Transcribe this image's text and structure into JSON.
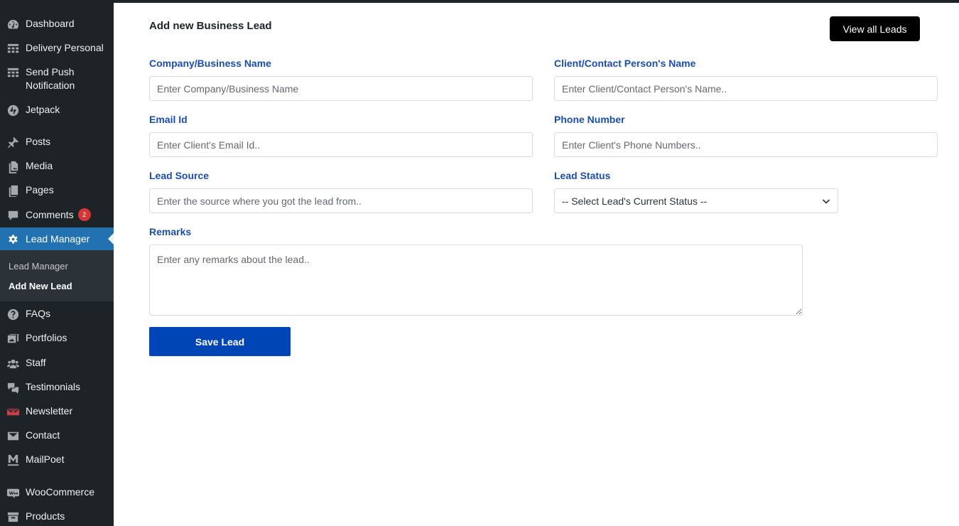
{
  "sidebar": {
    "items": [
      {
        "label": "Dashboard",
        "icon": "dashboard-icon"
      },
      {
        "label": "Delivery Personal",
        "icon": "table-icon"
      },
      {
        "label": "Send Push Notification",
        "icon": "table-icon"
      },
      {
        "label": "Jetpack",
        "icon": "jetpack-icon"
      },
      {
        "label": "Posts",
        "icon": "pin-icon"
      },
      {
        "label": "Media",
        "icon": "media-icon"
      },
      {
        "label": "Pages",
        "icon": "pages-icon"
      },
      {
        "label": "Comments",
        "icon": "comment-icon",
        "badge": "2"
      },
      {
        "label": "Lead Manager",
        "icon": "gear-icon"
      },
      {
        "label": "FAQs",
        "icon": "help-icon"
      },
      {
        "label": "Portfolios",
        "icon": "portfolio-icon"
      },
      {
        "label": "Staff",
        "icon": "groups-icon"
      },
      {
        "label": "Testimonials",
        "icon": "testimonial-icon"
      },
      {
        "label": "Newsletter",
        "icon": "newsletter-icon"
      },
      {
        "label": "Contact",
        "icon": "email-icon"
      },
      {
        "label": "MailPoet",
        "icon": "mailpoet-icon"
      },
      {
        "label": "WooCommerce",
        "icon": "woo-icon"
      },
      {
        "label": "Products",
        "icon": "archive-icon"
      }
    ],
    "submenu": [
      {
        "label": "Lead Manager"
      },
      {
        "label": "Add New Lead"
      }
    ]
  },
  "page": {
    "title": "Add new Business Lead",
    "view_all_label": "View all Leads"
  },
  "form": {
    "company": {
      "label": "Company/Business Name",
      "placeholder": "Enter Company/Business Name"
    },
    "contact": {
      "label": "Client/Contact Person's Name",
      "placeholder": "Enter Client/Contact Person's Name.."
    },
    "email": {
      "label": "Email Id",
      "placeholder": "Enter Client's Email Id.."
    },
    "phone": {
      "label": "Phone Number",
      "placeholder": "Enter Client's Phone Numbers.."
    },
    "source": {
      "label": "Lead Source",
      "placeholder": "Enter the source where you got the lead from.."
    },
    "status": {
      "label": "Lead Status",
      "selected": "-- Select Lead's Current Status --"
    },
    "remarks": {
      "label": "Remarks",
      "placeholder": "Enter any remarks about the lead.."
    },
    "save_label": "Save Lead"
  },
  "colors": {
    "sidebar_bg": "#1d2327",
    "active_item": "#2271b1",
    "label_blue": "#1b4eaa",
    "save_button": "#0045b5"
  }
}
